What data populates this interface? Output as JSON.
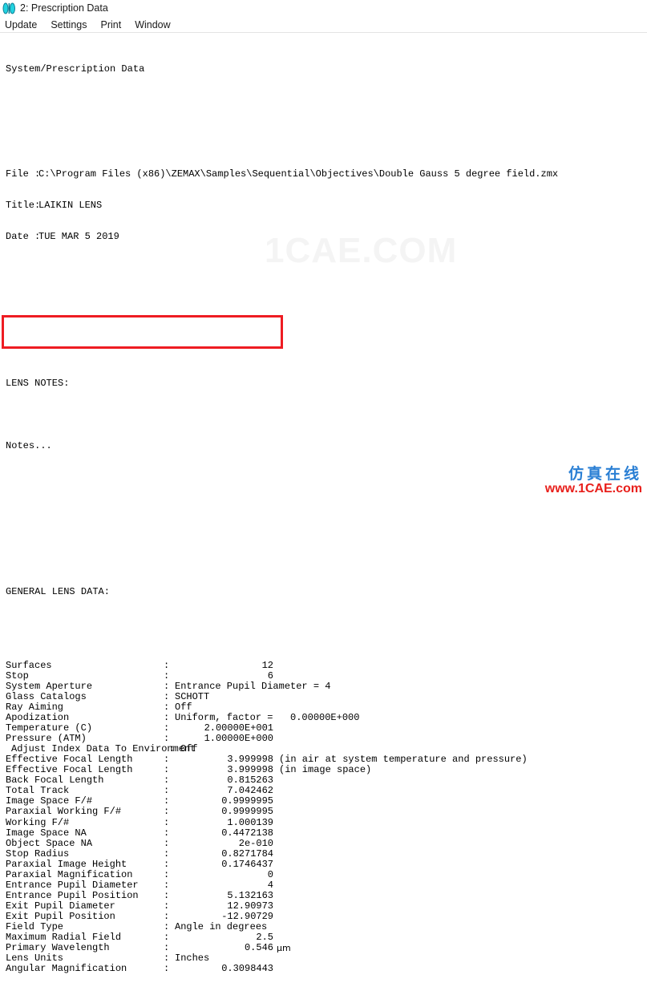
{
  "window": {
    "icon": "lens-icon",
    "title": "2: Prescription Data"
  },
  "menu": {
    "items": [
      {
        "label": "Update"
      },
      {
        "label": "Settings"
      },
      {
        "label": "Print"
      },
      {
        "label": "Window"
      }
    ]
  },
  "report": {
    "heading": "System/Prescription Data",
    "file_label": "File :",
    "file_value": "C:\\Program Files (x86)\\ZEMAX\\Samples\\Sequential\\Objectives\\Double Gauss 5 degree field.zmx",
    "title_label": "Title:",
    "title_value": "LAIKIN LENS",
    "date_label": "Date :",
    "date_value": "TUE MAR 5 2019",
    "notes_heading": "LENS NOTES:",
    "notes_value": "Notes...",
    "general_heading": "GENERAL LENS DATA:",
    "rows": [
      {
        "label": "Surfaces",
        "colon": ":",
        "value": "12",
        "kind": "num"
      },
      {
        "label": "Stop",
        "colon": ":",
        "value": "6",
        "kind": "num"
      },
      {
        "label": "System Aperture",
        "colon": ":",
        "value": "Entrance Pupil Diameter = 4",
        "kind": "txt"
      },
      {
        "label": "Glass Catalogs",
        "colon": ":",
        "value": "SCHOTT",
        "kind": "txt"
      },
      {
        "label": "Ray Aiming",
        "colon": ":",
        "value": "Off",
        "kind": "txt"
      },
      {
        "label": "Apodization",
        "colon": ":",
        "value": "Uniform, factor =   0.00000E+000",
        "kind": "txt"
      },
      {
        "label": "Temperature (C)",
        "colon": ":",
        "value": "2.00000E+001",
        "kind": "num"
      },
      {
        "label": "Pressure (ATM)",
        "colon": ":",
        "value": "1.00000E+000",
        "kind": "num"
      },
      {
        "label": "Adjust Index Data To Environment",
        "colon": ":",
        "value": "Off",
        "kind": "txt",
        "indent": true
      },
      {
        "label": "Effective Focal Length",
        "colon": ":",
        "value": "3.999998",
        "kind": "num",
        "tail": "(in air at system temperature and pressure)"
      },
      {
        "label": "Effective Focal Length",
        "colon": ":",
        "value": "3.999998",
        "kind": "num",
        "tail": "(in image space)"
      },
      {
        "label": "Back Focal Length",
        "colon": ":",
        "value": "0.815263",
        "kind": "num"
      },
      {
        "label": "Total Track",
        "colon": ":",
        "value": "7.042462",
        "kind": "num"
      },
      {
        "label": "Image Space F/#",
        "colon": ":",
        "value": "0.9999995",
        "kind": "num",
        "highlighted": true
      },
      {
        "label": "Paraxial Working F/#",
        "colon": ":",
        "value": "0.9999995",
        "kind": "num",
        "highlighted": true
      },
      {
        "label": "Working F/#",
        "colon": ":",
        "value": "1.000139",
        "kind": "num",
        "highlighted": true
      },
      {
        "label": "Image Space NA",
        "colon": ":",
        "value": "0.4472138",
        "kind": "num"
      },
      {
        "label": "Object Space NA",
        "colon": ":",
        "value": "2e-010",
        "kind": "num"
      },
      {
        "label": "Stop Radius",
        "colon": ":",
        "value": "0.8271784",
        "kind": "num"
      },
      {
        "label": "Paraxial Image Height",
        "colon": ":",
        "value": "0.1746437",
        "kind": "num"
      },
      {
        "label": "Paraxial Magnification",
        "colon": ":",
        "value": "0",
        "kind": "num"
      },
      {
        "label": "Entrance Pupil Diameter",
        "colon": ":",
        "value": "4",
        "kind": "num"
      },
      {
        "label": "Entrance Pupil Position",
        "colon": ":",
        "value": "5.132163",
        "kind": "num"
      },
      {
        "label": "Exit Pupil Diameter",
        "colon": ":",
        "value": "12.90973",
        "kind": "num"
      },
      {
        "label": "Exit Pupil Position",
        "colon": ":",
        "value": "-12.90729",
        "kind": "num"
      },
      {
        "label": "Field Type",
        "colon": ":",
        "value": "Angle in degrees",
        "kind": "txt"
      },
      {
        "label": "Maximum Radial Field",
        "colon": ":",
        "value": "2.5",
        "kind": "num"
      },
      {
        "label": "Primary Wavelength",
        "colon": ":",
        "value": "0.546",
        "kind": "num",
        "unit": "μm"
      },
      {
        "label": "Lens Units",
        "colon": ":",
        "value": "Inches",
        "kind": "txt"
      },
      {
        "label": "Angular Magnification",
        "colon": ":",
        "value": "0.3098443",
        "kind": "num"
      }
    ]
  },
  "highlight": {
    "color": "#ee1c22"
  },
  "watermarks": {
    "center_text": "1CAE.COM",
    "center_color": "#f4f4f4",
    "corner_cn": "仿真在线",
    "corner_cn_color": "#2a7fd4",
    "corner_url": "www.1CAE.com",
    "corner_url_color": "#e8201c"
  }
}
